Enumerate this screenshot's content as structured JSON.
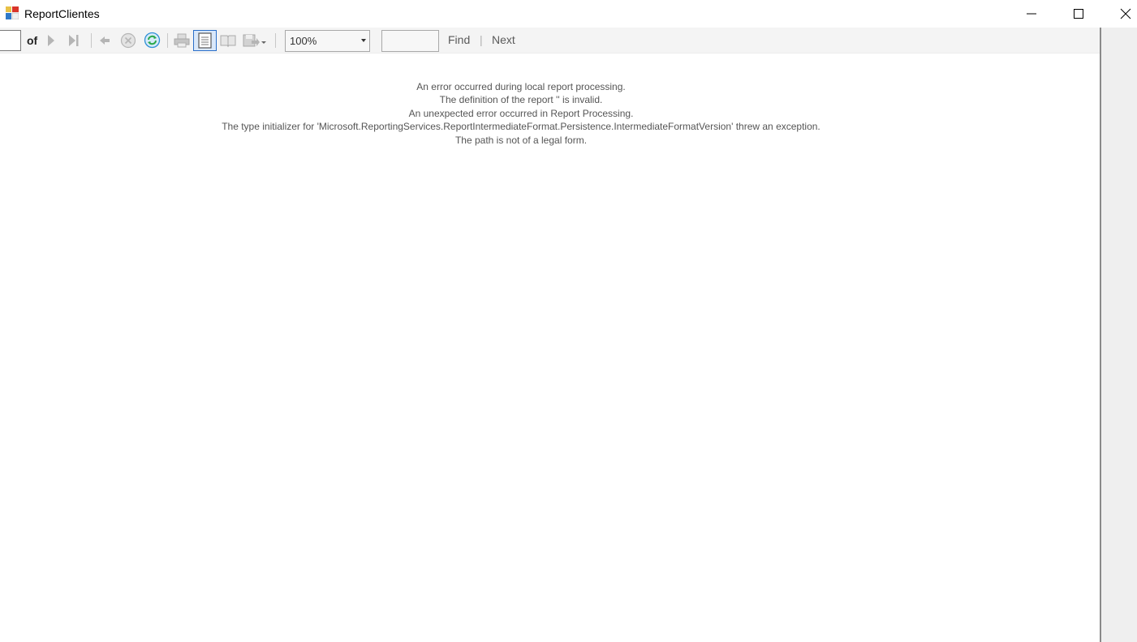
{
  "window": {
    "title": "ReportClientes",
    "icons": {
      "app": "report-app-icon",
      "minimize": "minimize-icon",
      "maximize": "maximize-icon",
      "close": "close-icon"
    }
  },
  "toolbar": {
    "current_page": "",
    "of_label": "of",
    "zoom": {
      "selected": "100%"
    },
    "find_text": "",
    "find_label": "Find",
    "separator": "|",
    "next_label": "Next",
    "icons": [
      "next-page-icon",
      "last-page-icon",
      "back-icon",
      "stop-icon",
      "refresh-icon",
      "print-icon",
      "print-layout-icon",
      "page-setup-icon",
      "export-icon"
    ]
  },
  "error": {
    "lines": [
      "An error occurred during local report processing.",
      "The definition of the report '' is invalid.",
      "An unexpected error occurred in Report Processing.",
      "The type initializer for 'Microsoft.ReportingServices.ReportIntermediateFormat.Persistence.IntermediateFormatVersion' threw an exception.",
      "The path is not of a legal form."
    ]
  },
  "colors": {
    "toolbar_bg": "#f4f4f4",
    "error_text": "#555555",
    "refresh_accent": "#2f8fd6",
    "selected_button": "#2a6fc9"
  }
}
